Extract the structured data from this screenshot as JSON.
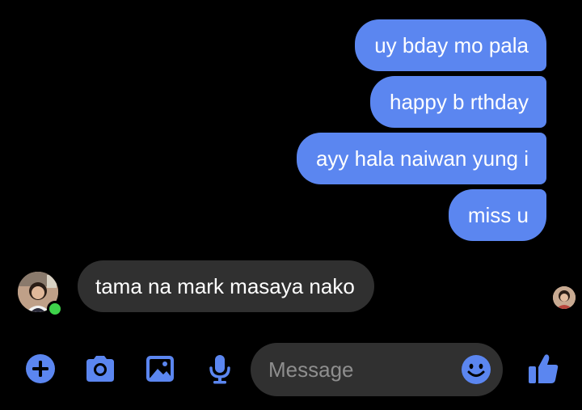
{
  "colors": {
    "accent": "#5b86f0",
    "background": "#000000",
    "received_bubble": "#303030",
    "online": "#3ed34a"
  },
  "messages": {
    "sent": [
      "uy bday mo pala",
      "happy b rthday",
      "ayy hala naiwan yung i",
      "miss u"
    ],
    "received": [
      "tama na mark masaya nako"
    ]
  },
  "composer": {
    "placeholder": "Message",
    "icons": [
      "add-icon",
      "camera-icon",
      "image-icon",
      "microphone-icon",
      "emoji-icon",
      "thumbs-up-icon"
    ]
  }
}
